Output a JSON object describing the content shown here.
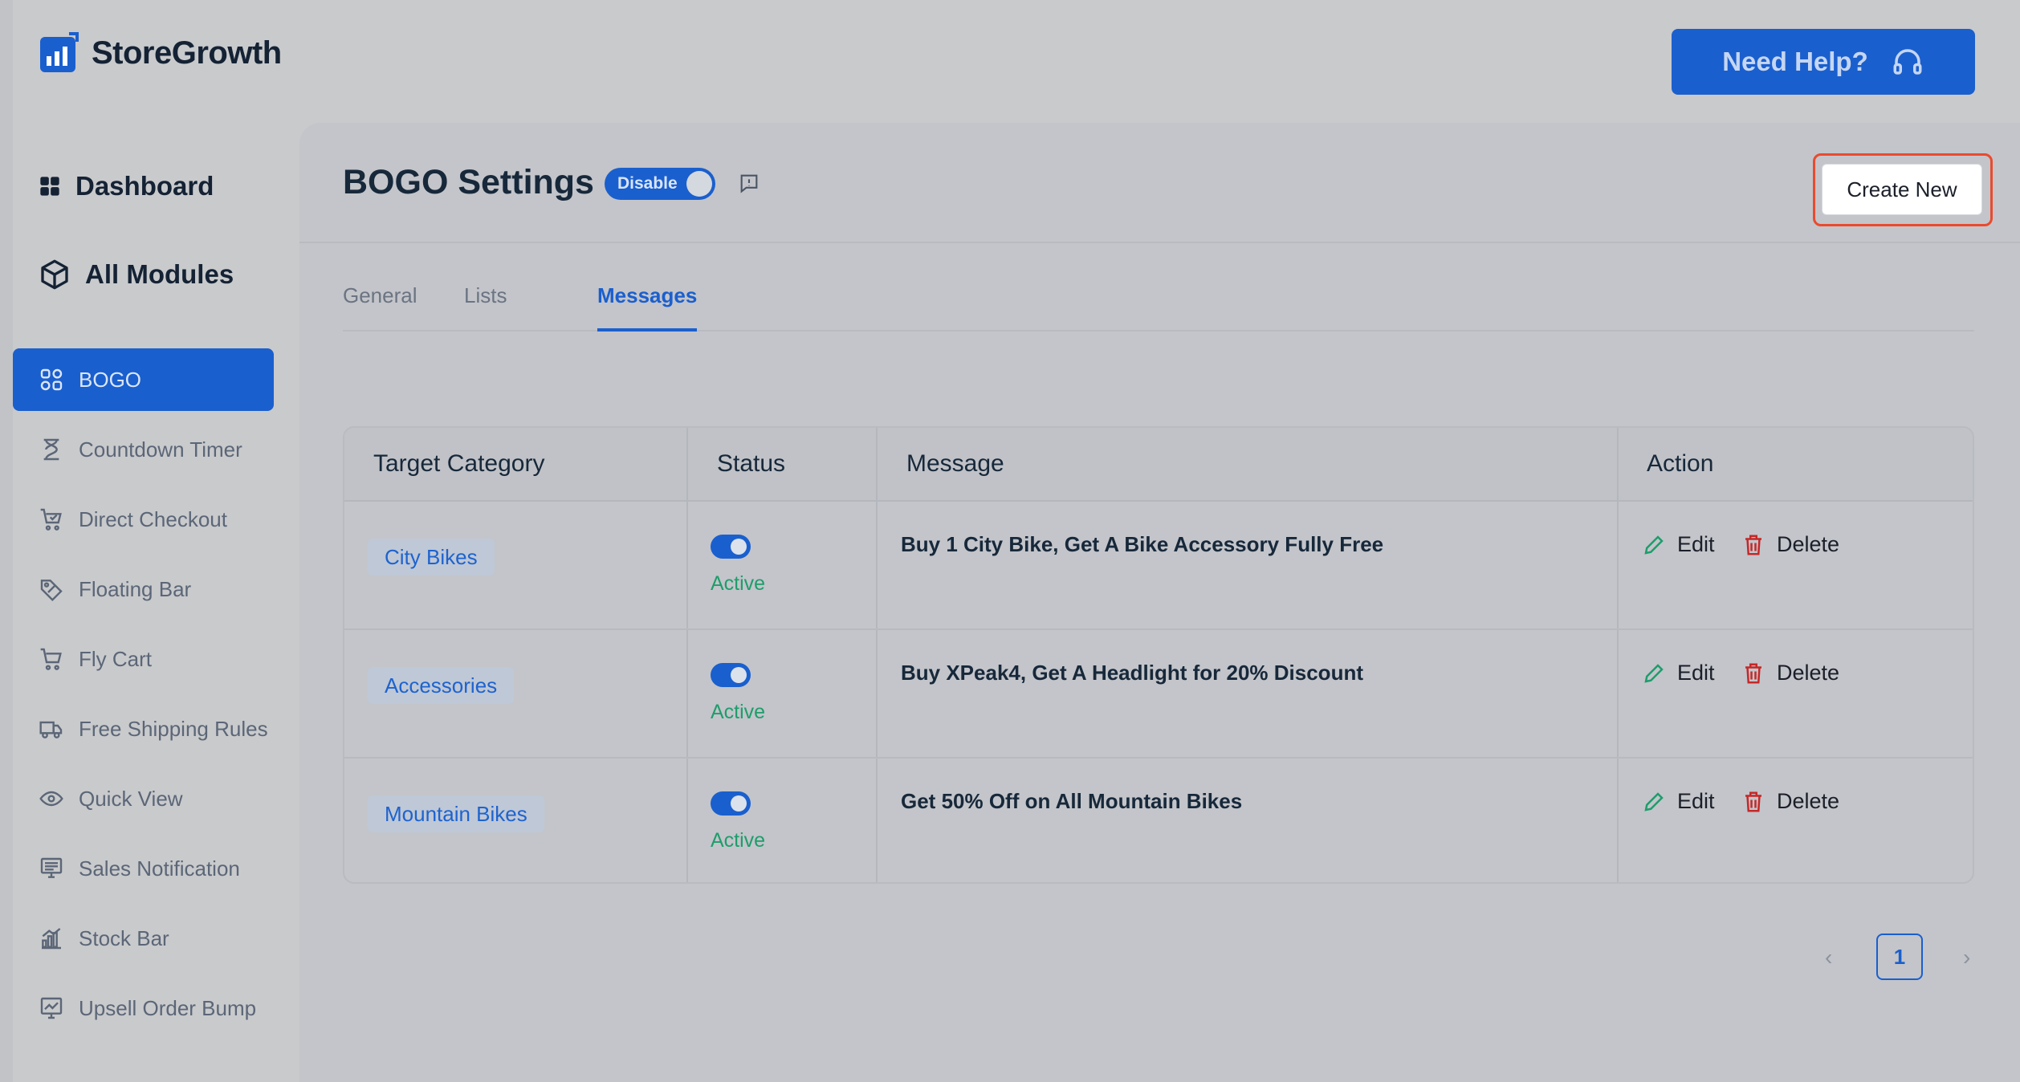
{
  "app": {
    "brand": "StoreGrowth"
  },
  "header": {
    "help_label": "Need Help?"
  },
  "sidebar": {
    "dashboard": "Dashboard",
    "all_modules": "All Modules",
    "items": [
      {
        "label": "BOGO",
        "icon": "bogo-icon",
        "active": true
      },
      {
        "label": "Countdown Timer",
        "icon": "hourglass-icon"
      },
      {
        "label": "Direct Checkout",
        "icon": "cart-check-icon"
      },
      {
        "label": "Floating Bar",
        "icon": "tag-icon"
      },
      {
        "label": "Fly Cart",
        "icon": "fly-cart-icon"
      },
      {
        "label": "Free Shipping Rules",
        "icon": "truck-icon"
      },
      {
        "label": "Quick View",
        "icon": "eye-icon"
      },
      {
        "label": "Sales Notification",
        "icon": "monitor-icon"
      },
      {
        "label": "Stock Bar",
        "icon": "bar-chart-icon"
      },
      {
        "label": "Upsell Order Bump",
        "icon": "trend-chart-icon"
      }
    ]
  },
  "page": {
    "title": "BOGO Settings",
    "toggle_label": "Disable",
    "create_label": "Create New",
    "tabs": [
      {
        "label": "General"
      },
      {
        "label": "Lists"
      },
      {
        "label": "Messages",
        "active": true
      }
    ]
  },
  "table": {
    "headers": {
      "category": "Target Category",
      "status": "Status",
      "message": "Message",
      "action": "Action"
    },
    "rows": [
      {
        "category": "City Bikes",
        "status": "Active",
        "message": "Buy 1 City Bike, Get A Bike Accessory Fully Free",
        "edit": "Edit",
        "delete": "Delete"
      },
      {
        "category": "Accessories",
        "status": "Active",
        "message": "Buy XPeak4, Get A Headlight for 20% Discount",
        "edit": "Edit",
        "delete": "Delete"
      },
      {
        "category": "Mountain Bikes",
        "status": "Active",
        "message": "Get 50% Off on All Mountain Bikes",
        "edit": "Edit",
        "delete": "Delete"
      }
    ]
  },
  "pagination": {
    "current": "1"
  },
  "colors": {
    "primary": "#1a5fce",
    "active_status": "#1f9d6b",
    "delete": "#c62828",
    "edit": "#1f9d6b",
    "highlight": "#ea4a2d"
  }
}
